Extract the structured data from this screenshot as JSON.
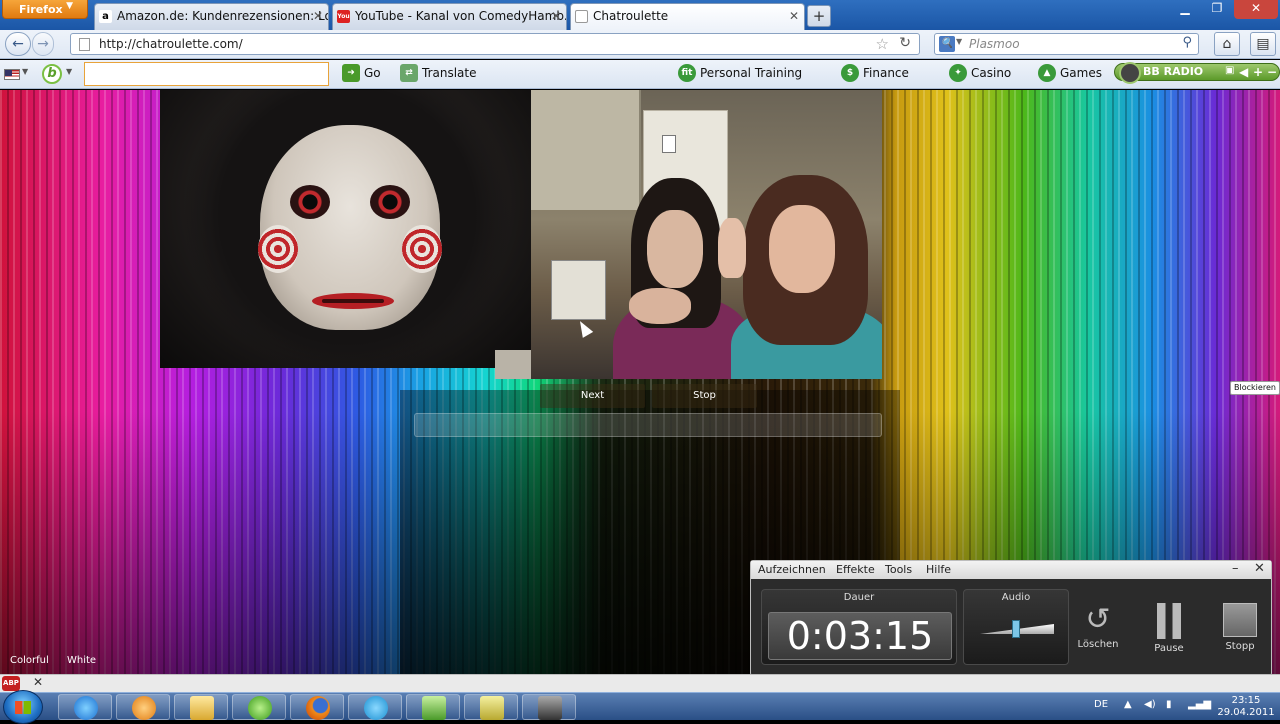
{
  "browser": {
    "menu_button": "Firefox",
    "tabs": [
      {
        "title": "Amazon.de: Kundenrezensionen: Log...",
        "icon": "amazon-icon",
        "active": false
      },
      {
        "title": "YouTube - Kanal von ComedyHamb...",
        "icon": "youtube-icon",
        "active": false
      },
      {
        "title": "Chatroulette",
        "icon": "page-icon",
        "active": true
      }
    ],
    "url": "http://chatroulette.com/",
    "search_placeholder": "Plasmoo"
  },
  "toolbar": {
    "search_value": "",
    "go_label": "Go",
    "translate_label": "Translate",
    "links": [
      "Personal Training",
      "Finance",
      "Casino",
      "Games"
    ],
    "radio_label": "BB RADIO"
  },
  "chatroulette": {
    "next_label": "Next",
    "stop_label": "Stop",
    "chat_input_value": "",
    "block_label": "Blockieren",
    "theme_colorful": "Colorful",
    "theme_white": "White"
  },
  "recorder": {
    "menu": [
      "Aufzeichnen",
      "Effekte",
      "Tools",
      "Hilfe"
    ],
    "duration_label": "Dauer",
    "duration_value": "0:03:15",
    "audio_label": "Audio",
    "audio_level": 0.5,
    "buttons": [
      "Löschen",
      "Pause",
      "Stopp"
    ]
  },
  "taskbar": {
    "language": "DE",
    "time": "23:15",
    "date": "29.04.2011"
  },
  "colors": {
    "accent_tab_bar": "#1b56a6",
    "firefox_button": "#e07a10",
    "toolbar_input_border": "#e8a33a"
  }
}
